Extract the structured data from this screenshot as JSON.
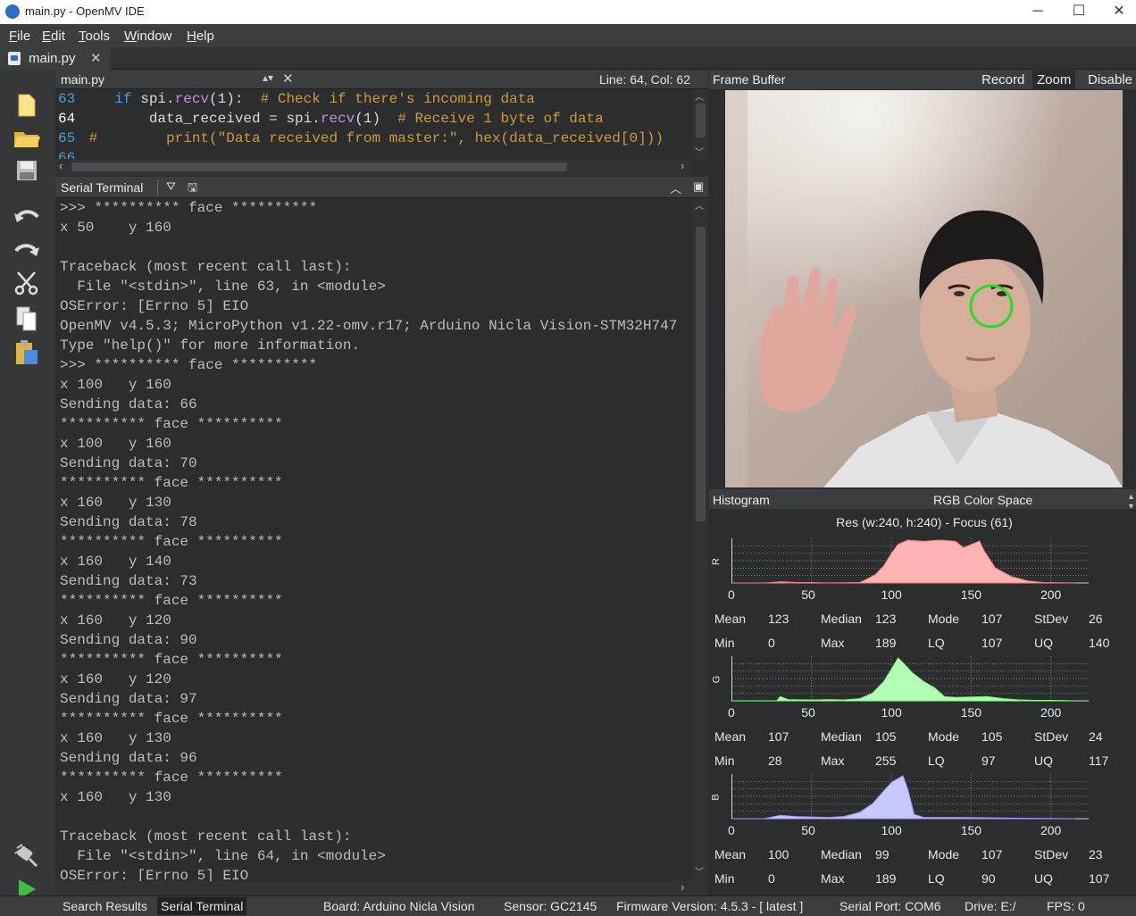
{
  "window": {
    "title": "main.py - OpenMV IDE",
    "minimize": "─",
    "maximize": "☐",
    "close": "✕"
  },
  "menu": [
    "File",
    "Edit",
    "Tools",
    "Window",
    "Help"
  ],
  "tab": {
    "label": "main.py",
    "close": "✕"
  },
  "editor": {
    "filename": "main.py",
    "position": "Line: 64, Col: 62",
    "lines": [
      {
        "n": "63",
        "indent": "    ",
        "kw": "if",
        "pre": " spi.",
        "fn": "recv",
        "post": "(1):  ",
        "comment": "# Check if there's incoming data"
      },
      {
        "n": "64",
        "indent": "        ",
        "kw": "",
        "pre": "data_received = spi.",
        "fn": "recv",
        "post": "(1)  ",
        "comment": "# Receive 1 byte of data"
      },
      {
        "n": "65",
        "indent": " ",
        "kw": "",
        "pre": "",
        "fn": "",
        "post": "",
        "comment": "#        print(\"Data received from master:\", hex(data_received[0]))"
      },
      {
        "n": "66",
        "indent": "",
        "kw": "",
        "pre": "",
        "fn": "",
        "post": "",
        "comment": ""
      }
    ]
  },
  "terminal": {
    "title": "Serial Terminal",
    "lines": [
      ">>> ********** face **********",
      "x 50    y 160",
      "",
      "Traceback (most recent call last):",
      "  File \"<stdin>\", line 63, in <module>",
      "OSError: [Errno 5] EIO",
      "OpenMV v4.5.3; MicroPython v1.22-omv.r17; Arduino Nicla Vision-STM32H747",
      "Type \"help()\" for more information.",
      ">>> ********** face **********",
      "x 100   y 160",
      "Sending data: 66",
      "********** face **********",
      "x 100   y 160",
      "Sending data: 70",
      "********** face **********",
      "x 160   y 130",
      "Sending data: 78",
      "********** face **********",
      "x 160   y 140",
      "Sending data: 73",
      "********** face **********",
      "x 160   y 120",
      "Sending data: 90",
      "********** face **********",
      "x 160   y 120",
      "Sending data: 97",
      "********** face **********",
      "x 160   y 130",
      "Sending data: 96",
      "********** face **********",
      "x 160   y 130",
      "",
      "Traceback (most recent call last):",
      "  File \"<stdin>\", line 64, in <module>",
      "OSError: [Errno 5] EIO"
    ]
  },
  "framebuffer": {
    "title": "Frame Buffer",
    "record": "Record",
    "zoom": "Zoom",
    "disable": "Disable"
  },
  "histogram": {
    "title": "Histogram",
    "color_space": "RGB Color Space",
    "resolution": "Res (w:240, h:240) - Focus (61)",
    "axis_ticks": [
      "0",
      "50",
      "100",
      "150",
      "200"
    ],
    "channels": [
      {
        "label": "R",
        "color": "#ffb3b3",
        "stroke": "#ff8080",
        "mean": "123",
        "median": "123",
        "mode": "107",
        "stdev": "26",
        "min": "0",
        "max": "189",
        "lq": "107",
        "uq": "140",
        "curve": [
          [
            0,
            0
          ],
          [
            20,
            0
          ],
          [
            25,
            1
          ],
          [
            30,
            3
          ],
          [
            35,
            2
          ],
          [
            40,
            1
          ],
          [
            50,
            1
          ],
          [
            60,
            0
          ],
          [
            80,
            1
          ],
          [
            85,
            10
          ],
          [
            90,
            20
          ],
          [
            95,
            40
          ],
          [
            100,
            70
          ],
          [
            104,
            90
          ],
          [
            110,
            100
          ],
          [
            120,
            97
          ],
          [
            130,
            100
          ],
          [
            140,
            97
          ],
          [
            145,
            82
          ],
          [
            150,
            90
          ],
          [
            155,
            98
          ],
          [
            158,
            75
          ],
          [
            165,
            35
          ],
          [
            175,
            15
          ],
          [
            185,
            5
          ],
          [
            195,
            1
          ],
          [
            215,
            0
          ]
        ]
      },
      {
        "label": "G",
        "color": "#b3ffb3",
        "stroke": "#80ff80",
        "mean": "107",
        "median": "105",
        "mode": "105",
        "stdev": "24",
        "min": "28",
        "max": "255",
        "lq": "97",
        "uq": "117",
        "curve": [
          [
            0,
            0
          ],
          [
            28,
            0
          ],
          [
            30,
            10
          ],
          [
            35,
            3
          ],
          [
            45,
            2
          ],
          [
            55,
            2
          ],
          [
            60,
            3
          ],
          [
            70,
            2
          ],
          [
            80,
            5
          ],
          [
            88,
            18
          ],
          [
            95,
            45
          ],
          [
            100,
            75
          ],
          [
            104,
            100
          ],
          [
            108,
            85
          ],
          [
            113,
            65
          ],
          [
            120,
            45
          ],
          [
            127,
            30
          ],
          [
            133,
            10
          ],
          [
            140,
            8
          ],
          [
            150,
            9
          ],
          [
            160,
            10
          ],
          [
            170,
            5
          ],
          [
            180,
            2
          ],
          [
            190,
            1
          ],
          [
            200,
            1
          ],
          [
            215,
            0
          ]
        ]
      },
      {
        "label": "B",
        "color": "#c8c8ff",
        "stroke": "#9a9aff",
        "mean": "100",
        "median": "99",
        "mode": "107",
        "stdev": "23",
        "min": "0",
        "max": "189",
        "lq": "90",
        "uq": "107",
        "curve": [
          [
            0,
            0
          ],
          [
            20,
            0
          ],
          [
            30,
            8
          ],
          [
            40,
            5
          ],
          [
            60,
            3
          ],
          [
            70,
            5
          ],
          [
            80,
            15
          ],
          [
            88,
            35
          ],
          [
            95,
            65
          ],
          [
            100,
            85
          ],
          [
            107,
            100
          ],
          [
            110,
            70
          ],
          [
            114,
            10
          ],
          [
            120,
            3
          ],
          [
            140,
            3
          ],
          [
            160,
            2
          ],
          [
            180,
            1
          ],
          [
            215,
            0
          ]
        ]
      }
    ],
    "stat_labels": {
      "mean": "Mean",
      "median": "Median",
      "mode": "Mode",
      "stdev": "StDev",
      "min": "Min",
      "max": "Max",
      "lq": "LQ",
      "uq": "UQ"
    }
  },
  "statusbar": {
    "search": "Search Results",
    "serial": "Serial Terminal",
    "board": "Board: Arduino Nicla Vision",
    "sensor": "Sensor: GC2145",
    "firmware": "Firmware Version: 4.5.3 - [ latest ]",
    "port": "Serial Port: COM6",
    "drive": "Drive: E:/",
    "fps": "FPS: 0"
  }
}
